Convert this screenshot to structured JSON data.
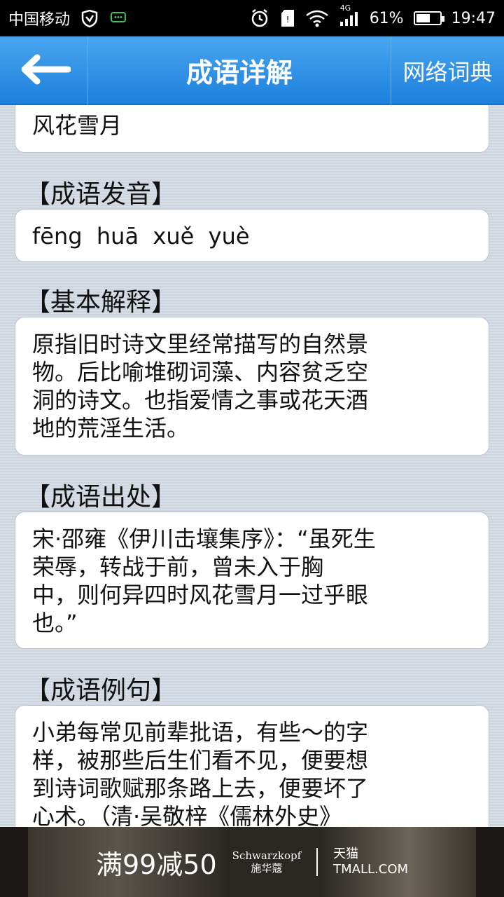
{
  "status": {
    "carrier": "中国移动",
    "network": "4G",
    "battery": "61%",
    "battery_level": 0.61,
    "time": "19:47"
  },
  "header": {
    "title": "成语详解",
    "right_button": "网络词典"
  },
  "idiom": {
    "name": "风花雪月"
  },
  "sections": {
    "pronunciation": {
      "label": "【成语发音】",
      "text": "fēng  huā  xuě  yuè"
    },
    "meaning": {
      "label": "【基本解释】",
      "lines": [
        "原指旧时诗文里经常描写的自然景",
        "物。后比喻堆砌词藻、内容贫乏空",
        "洞的诗文。也指爱情之事或花天酒",
        "地的荒淫生活。"
      ]
    },
    "source": {
      "label": "【成语出处】",
      "lines": [
        "宋·邵雍《伊川击壤集序》：“虽死生",
        "荣辱，转战于前，曾未入于胸",
        "中，则何异四时风花雪月一过乎眼",
        "也。”"
      ]
    },
    "example": {
      "label": "【成语例句】",
      "lines": [
        "小弟每常见前辈批语，有些～的字",
        "样，被那些后生们看不见，便要想",
        "到诗词歌赋那条路上去，便要坏了",
        "心术。（清·吴敬梓《儒林外史》"
      ]
    }
  },
  "ad": {
    "promo": "满99减50",
    "brand_line1": "Schwarzkopf",
    "brand_line2": "施华蔻",
    "mall_line1": "天猫",
    "mall_line2": "TMALL.COM"
  }
}
